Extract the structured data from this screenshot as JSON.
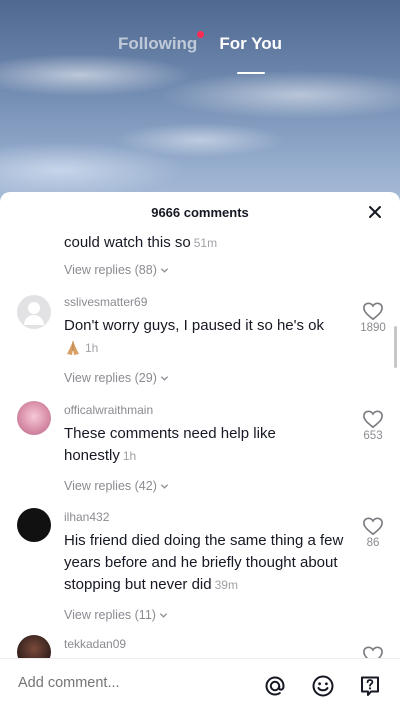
{
  "nav": {
    "tabs": [
      {
        "label": "Following"
      },
      {
        "label": "For You"
      }
    ]
  },
  "sheet": {
    "title": "9666 comments"
  },
  "comments": [
    {
      "text": "could watch this so",
      "time": "51m",
      "replies": "View replies (88)"
    },
    {
      "username": "sslivesmatter69",
      "text": "Don't worry guys, I paused it so he's ok",
      "time": "1h",
      "likes": "1890",
      "replies": "View replies (29)"
    },
    {
      "username": "officalwraithmain",
      "text": "These comments need help like honestly",
      "time": "1h",
      "likes": "653",
      "replies": "View replies (42)"
    },
    {
      "username": "ilhan432",
      "text": "His friend died doing the same thing a few years before and he briefly thought about stopping but never did",
      "time": "39m",
      "likes": "86",
      "replies": "View replies (11)"
    },
    {
      "username": "tekkadan09"
    }
  ],
  "footer": {
    "placeholder": "Add comment..."
  },
  "colors": {
    "accent": "#fe2c55",
    "text": "#161823",
    "muted": "#8a8b91"
  },
  "icons": [
    "close-icon",
    "heart-icon",
    "chevron-down-icon",
    "at-icon",
    "emoji-icon",
    "question-icon",
    "praying-hands-emoji"
  ]
}
